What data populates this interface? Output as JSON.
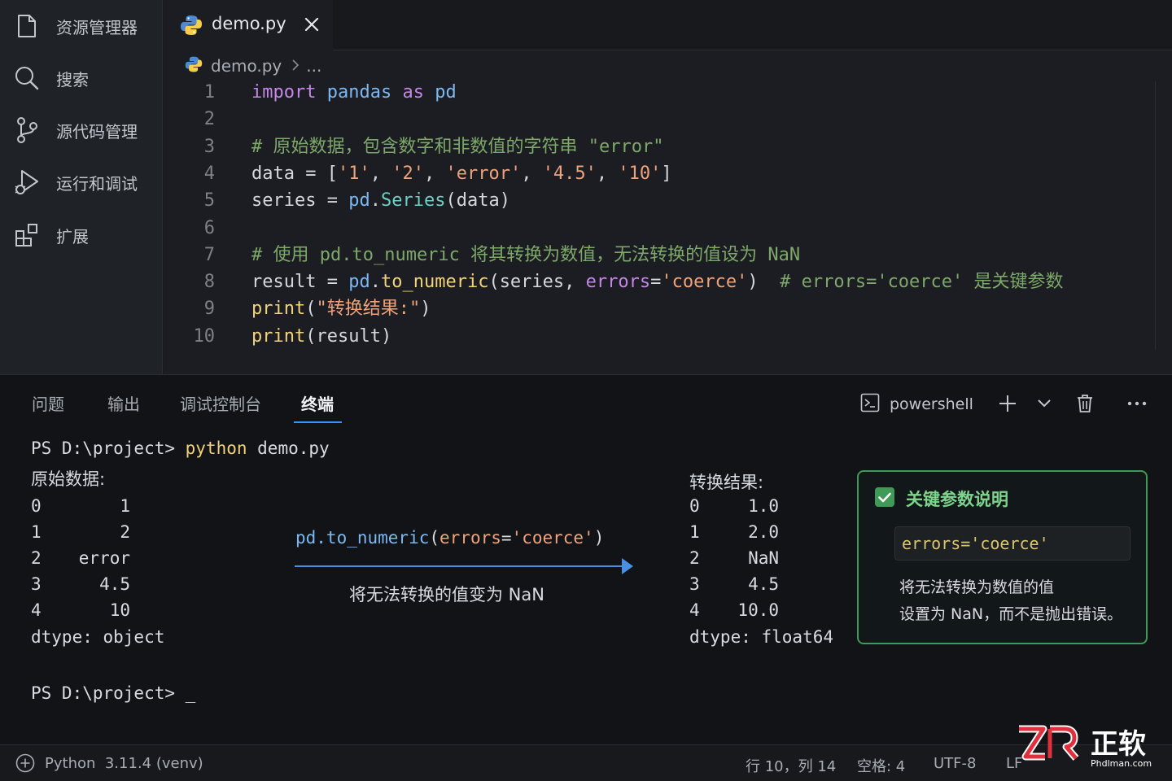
{
  "sidebar": {
    "items": [
      {
        "label": "资源管理器",
        "icon": "files-icon"
      },
      {
        "label": "搜索",
        "icon": "search-icon"
      },
      {
        "label": "源代码管理",
        "icon": "source-control-icon"
      },
      {
        "label": "运行和调试",
        "icon": "run-debug-icon"
      },
      {
        "label": "扩展",
        "icon": "extensions-icon"
      }
    ]
  },
  "editor": {
    "tab": {
      "name": "demo.py"
    },
    "breadcrumb": {
      "file": "demo.py",
      "rest": "..."
    },
    "line_numbers": [
      "1",
      "2",
      "3",
      "4",
      "5",
      "6",
      "7",
      "8",
      "9",
      "10"
    ],
    "lines": [
      [
        [
          "import",
          "kw"
        ],
        [
          " ",
          "pn"
        ],
        [
          "pandas",
          "mod"
        ],
        [
          " ",
          "pn"
        ],
        [
          "as",
          "kw"
        ],
        [
          " ",
          "pn"
        ],
        [
          "pd",
          "mod"
        ]
      ],
      [],
      [
        [
          "# 原始数据，包含数字和非数值的字符串 \"error\"",
          "cm"
        ]
      ],
      [
        [
          "data",
          "id"
        ],
        [
          " = [",
          "pn"
        ],
        [
          "'1'",
          "str"
        ],
        [
          ", ",
          "pn"
        ],
        [
          "'2'",
          "str"
        ],
        [
          ", ",
          "pn"
        ],
        [
          "'error'",
          "str"
        ],
        [
          ", ",
          "pn"
        ],
        [
          "'4.5'",
          "str"
        ],
        [
          ", ",
          "pn"
        ],
        [
          "'10'",
          "str"
        ],
        [
          "]",
          "pn"
        ]
      ],
      [
        [
          "series",
          "id"
        ],
        [
          " = ",
          "pn"
        ],
        [
          "pd",
          "mod"
        ],
        [
          ".",
          "pn"
        ],
        [
          "Series",
          "cls"
        ],
        [
          "(",
          "pn"
        ],
        [
          "data",
          "id"
        ],
        [
          ")",
          "pn"
        ]
      ],
      [],
      [
        [
          "# 使用 pd.to_numeric 将其转换为数值，无法转换的值设为 NaN",
          "cm"
        ]
      ],
      [
        [
          "result",
          "id"
        ],
        [
          " = ",
          "pn"
        ],
        [
          "pd",
          "mod"
        ],
        [
          ".",
          "pn"
        ],
        [
          "to_numeric",
          "fn"
        ],
        [
          "(",
          "pn"
        ],
        [
          "series",
          "id"
        ],
        [
          ", ",
          "pn"
        ],
        [
          "errors",
          "prm"
        ],
        [
          "=",
          "pn"
        ],
        [
          "'coerce'",
          "str"
        ],
        [
          ")",
          "pn"
        ],
        [
          "  # errors='coerce' 是关键参数",
          "cm"
        ]
      ],
      [
        [
          "print",
          "fn"
        ],
        [
          "(",
          "pn"
        ],
        [
          "\"转换结果:\"",
          "str"
        ],
        [
          ")",
          "pn"
        ]
      ],
      [
        [
          "print",
          "fn"
        ],
        [
          "(",
          "pn"
        ],
        [
          "result",
          "id"
        ],
        [
          ")",
          "pn"
        ]
      ]
    ]
  },
  "panel": {
    "tabs": [
      "问题",
      "输出",
      "调试控制台",
      "终端"
    ],
    "active_tab": "终端",
    "shell": "powershell",
    "terminal": {
      "prompt1": "PS D:\\project> ",
      "cmd": "python",
      "args": " demo.py",
      "orig_title": "原始数据:",
      "orig_rows": [
        [
          "0",
          "1"
        ],
        [
          "1",
          "2"
        ],
        [
          "2",
          "error"
        ],
        [
          "3",
          "4.5"
        ],
        [
          "4",
          "10"
        ]
      ],
      "orig_dtype": "dtype: object",
      "prompt2": "PS D:\\project> _",
      "result_title": "转换结果:",
      "result_rows": [
        [
          "0",
          "1.0"
        ],
        [
          "1",
          "2.0"
        ],
        [
          "2",
          "NaN"
        ],
        [
          "3",
          "4.5"
        ],
        [
          "4",
          "10.0"
        ]
      ],
      "result_dtype": "dtype: float64"
    },
    "arrow": {
      "code_fn": "pd.to_numeric",
      "code_open": "(",
      "code_param": "errors",
      "code_eq": "=",
      "code_val": "'coerce'",
      "code_close": ")",
      "caption": "将无法转换的值变为 NaN"
    },
    "key_box": {
      "title": "关键参数说明",
      "code": "errors='coerce'",
      "desc1": "将无法转换为数值的值",
      "desc2": "设置为 NaN，而不是抛出错误。"
    }
  },
  "statusbar": {
    "python": "Python",
    "version": "3.11.4 (venv)",
    "position": "行 10，列 14",
    "spaces": "空格: 4",
    "encoding": "UTF-8",
    "eol": "LF"
  },
  "watermark": {
    "brand": "正软",
    "site": "Phdlman.com"
  },
  "colors": {
    "accent": "#3794ff",
    "green": "#3e9a56"
  }
}
